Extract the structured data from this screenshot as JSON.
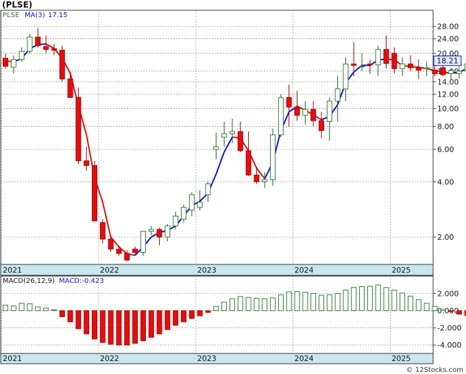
{
  "title": "(PLSE)",
  "footer": "© 12Stocks.com",
  "colors": {
    "up": "#2e7d32",
    "down": "#e01010",
    "ma_line": "#1010d0",
    "ma_red": "#e01010",
    "grid": "#9a9a9a",
    "axis_band": "#c8e6ee",
    "price_tag_bg": "#ddeeff"
  },
  "x_years": [
    "2021",
    "2022",
    "2023",
    "2024",
    "2025"
  ],
  "price_chart": {
    "ticker": "PLSE",
    "ma_label": "MA(3)",
    "ma_value": "17.15",
    "last_price": "18.21",
    "y_scale": "log",
    "ylim": [
      1.42,
      34
    ],
    "y_ticks": [
      2.0,
      4.0,
      6.0,
      8.0,
      10.0,
      12.0,
      14.0,
      16.0,
      20.0,
      24.0,
      28.0
    ],
    "y_tick_labels": [
      "2.00",
      "4.00",
      "6.00",
      "8.00",
      "10.00",
      "12.00",
      "14.00",
      "16.00",
      "20.00",
      "24.00",
      "28.00"
    ]
  },
  "macd_chart": {
    "label": "MACD(26,12,9)",
    "value_label": "MACD:-0.423",
    "ylim": [
      -4.9,
      3.0
    ],
    "y_ticks": [
      2.0,
      0.0,
      -2.0,
      -4.0
    ],
    "y_tick_labels": [
      "2.000",
      "0.000",
      "-2.000",
      "-4.000"
    ]
  },
  "chart_data": {
    "type": "candlestick",
    "frequency": "monthly",
    "months": [
      "2021-01",
      "2021-02",
      "2021-03",
      "2021-04",
      "2021-05",
      "2021-06",
      "2021-07",
      "2021-08",
      "2021-09",
      "2021-10",
      "2021-11",
      "2021-12",
      "2022-01",
      "2022-02",
      "2022-03",
      "2022-04",
      "2022-05",
      "2022-06",
      "2022-07",
      "2022-08",
      "2022-09",
      "2022-10",
      "2022-11",
      "2022-12",
      "2023-01",
      "2023-02",
      "2023-03",
      "2023-04",
      "2023-05",
      "2023-06",
      "2023-07",
      "2023-08",
      "2023-09",
      "2023-10",
      "2023-11",
      "2023-12",
      "2024-01",
      "2024-02",
      "2024-03",
      "2024-04",
      "2024-05",
      "2024-06",
      "2024-07",
      "2024-08",
      "2024-09",
      "2024-10",
      "2024-11",
      "2024-12",
      "2025-01",
      "2025-02",
      "2025-03",
      "2025-04",
      "2025-05",
      "2025-06",
      "2025-07",
      "2025-08",
      "2025-09",
      "2025-10",
      "2025-11",
      "2025-12"
    ],
    "open": [
      18.8,
      16.8,
      18.5,
      20.5,
      24.5,
      21.8,
      21.2,
      20.8,
      14.5,
      11.5,
      5.2,
      4.9,
      2.4,
      1.95,
      1.72,
      1.63,
      1.72,
      1.65,
      2.15,
      2.2,
      2.0,
      2.3,
      2.5,
      2.8,
      2.9,
      3.4,
      6.0,
      7.0,
      7.3,
      7.5,
      5.9,
      4.35,
      4.0,
      4.1,
      7.2,
      11.5,
      10.2,
      9.2,
      9.9,
      8.6,
      8.5,
      11.0,
      12.8,
      17.5,
      17.0,
      17.5,
      17.3,
      21.0,
      20.0,
      16.5,
      17.5,
      16.8,
      16.5,
      16.2,
      16.7,
      15.5,
      15.5,
      16.0,
      17.5,
      18.0
    ],
    "high": [
      19.9,
      19.5,
      21.5,
      25.5,
      27.5,
      25.0,
      22.5,
      22.0,
      15.8,
      13.0,
      6.2,
      5.2,
      2.5,
      2.05,
      1.8,
      1.7,
      1.78,
      2.1,
      2.3,
      2.25,
      2.35,
      2.75,
      3.0,
      3.5,
      3.6,
      4.0,
      7.4,
      8.5,
      8.8,
      8.5,
      7.5,
      4.8,
      4.5,
      7.8,
      12.0,
      13.5,
      12.5,
      11.0,
      11.0,
      9.6,
      11.5,
      15.0,
      19.0,
      23.0,
      20.0,
      18.5,
      22.0,
      25.0,
      21.5,
      19.0,
      19.5,
      18.5,
      18.0,
      17.5,
      17.5,
      16.5,
      17.0,
      18.5,
      19.5,
      20.5
    ],
    "low": [
      16.5,
      15.5,
      18.0,
      20.0,
      21.5,
      20.0,
      19.5,
      14.0,
      12.0,
      5.0,
      4.6,
      2.9,
      1.85,
      1.66,
      1.58,
      1.48,
      1.6,
      1.58,
      2.05,
      1.8,
      1.9,
      2.2,
      2.4,
      2.6,
      2.8,
      3.1,
      5.3,
      6.2,
      6.5,
      5.8,
      4.3,
      3.9,
      3.7,
      3.8,
      7.0,
      8.0,
      8.6,
      8.2,
      8.0,
      6.9,
      6.7,
      8.5,
      11.0,
      15.0,
      16.0,
      15.5,
      15.0,
      16.5,
      15.5,
      15.0,
      16.0,
      14.5,
      15.0,
      15.0,
      15.0,
      14.5,
      14.5,
      14.8,
      15.5,
      17.0
    ],
    "close": [
      17.0,
      18.5,
      20.5,
      24.5,
      22.0,
      21.0,
      20.8,
      14.5,
      11.5,
      5.2,
      4.9,
      2.45,
      1.95,
      1.72,
      1.63,
      1.5,
      1.65,
      2.15,
      2.2,
      2.0,
      2.3,
      2.6,
      2.9,
      3.4,
      3.1,
      3.9,
      6.2,
      7.3,
      7.5,
      5.9,
      4.35,
      4.0,
      4.1,
      7.2,
      11.5,
      10.2,
      9.2,
      9.9,
      8.6,
      7.6,
      11.0,
      12.8,
      17.5,
      17.2,
      17.0,
      17.3,
      21.0,
      17.6,
      16.5,
      17.5,
      16.7,
      16.2,
      16.7,
      15.5,
      15.3,
      16.1,
      16.0,
      17.5,
      18.0,
      18.21
    ],
    "ma3": [
      18.2,
      18.0,
      18.7,
      21.2,
      22.3,
      22.5,
      21.3,
      18.8,
      15.6,
      10.4,
      7.2,
      4.2,
      3.1,
      2.0,
      1.77,
      1.62,
      1.59,
      1.77,
      2.0,
      2.12,
      2.17,
      2.3,
      2.6,
      2.97,
      3.13,
      3.47,
      4.4,
      5.8,
      7.0,
      6.9,
      5.9,
      4.75,
      4.15,
      5.1,
      7.6,
      9.6,
      10.3,
      9.8,
      9.23,
      8.7,
      9.07,
      10.5,
      13.8,
      15.8,
      17.2,
      17.2,
      18.4,
      18.6,
      18.4,
      17.2,
      16.9,
      16.8,
      16.5,
      16.1,
      15.8,
      15.6,
      15.8,
      16.5,
      17.2,
      17.9
    ],
    "macd": [
      0.65,
      0.55,
      0.85,
      0.8,
      0.45,
      0.3,
      0.1,
      -0.7,
      -1.3,
      -2.1,
      -2.7,
      -3.3,
      -3.7,
      -3.9,
      -4.0,
      -4.0,
      -3.8,
      -3.5,
      -3.1,
      -2.7,
      -2.2,
      -1.7,
      -1.3,
      -0.9,
      -0.6,
      -0.2,
      0.5,
      1.0,
      1.4,
      1.65,
      1.55,
      1.45,
      1.4,
      1.5,
      1.85,
      2.2,
      2.25,
      2.15,
      2.0,
      1.8,
      1.85,
      2.0,
      2.4,
      2.7,
      2.8,
      2.85,
      3.0,
      2.7,
      2.4,
      2.05,
      1.7,
      1.3,
      0.85,
      0.5,
      0.15,
      -0.1,
      -0.4,
      -0.55,
      -0.6,
      -0.42
    ],
    "first_month_index": 0
  }
}
